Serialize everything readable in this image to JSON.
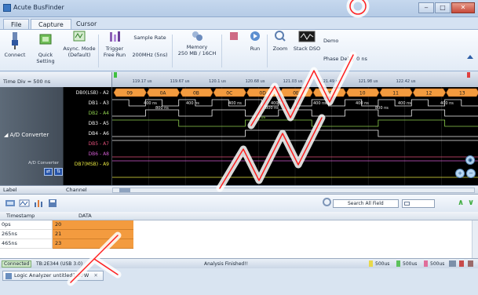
{
  "window": {
    "title": "Acute BusFinder",
    "min": "‒",
    "max": "□",
    "close": "✕"
  },
  "ribbon_tabs": [
    "File",
    "Capture",
    "Cursor"
  ],
  "ribbon": {
    "connect": "Connect",
    "quick_setting": "Quick Setting",
    "async_mode": "Async. Mode",
    "async_default": "(Default)",
    "trigger": "Trigger",
    "free_run": "Free Run",
    "sample_rate": "Sample Rate",
    "sample_rate_val": "200MHz (5ns)",
    "memory": "Memory",
    "memory_val": "250 MB / 16CH",
    "run": "Run",
    "zoom": "Zoom",
    "stack_dso": "Stack DSO",
    "demo": "Demo",
    "phase_delay": "Phase Delay 0 ns"
  },
  "waveform": {
    "time_div": "Time Div = 500 ns",
    "ruler": [
      "119.17 us",
      "119.67 us",
      "120.1 us",
      "120.68 us",
      "121.03 us",
      "121.49 us",
      "121.98 us",
      "122.42 us"
    ],
    "group_label": "A/D Converter",
    "group_label_small": "A/D Converter",
    "channels": [
      {
        "name": "DB0(LSB) - A2",
        "color": "#f0f0f0"
      },
      {
        "name": "DB1 - A3",
        "color": "#f0f0f0"
      },
      {
        "name": "DB2 - A4",
        "color": "#8fd14f"
      },
      {
        "name": "DB3 - A5",
        "color": "#f0f0f0"
      },
      {
        "name": "DB4 - A6",
        "color": "#f0f0f0"
      },
      {
        "name": "DB5 - A7",
        "color": "#e0507a"
      },
      {
        "name": "DB6 - A8",
        "color": "#d05cd0"
      },
      {
        "name": "DB7(MSB) - A9",
        "color": "#e8e840"
      }
    ],
    "bus_values": [
      "09",
      "0A",
      "0B",
      "0C",
      "0D",
      "0E",
      "0F",
      "10",
      "11",
      "12",
      "13"
    ],
    "pulse_labels": [
      "400 ns",
      "400 ns",
      "400 ns",
      "400 ns",
      "400 ns",
      "400 ns",
      "400 ns",
      "400 ns"
    ],
    "pulse_labels_2": [
      "800 ns",
      "800 ns",
      "800 ns"
    ],
    "pulse_label_3": "1.6 us",
    "bus_color": "#f39b3f"
  },
  "label_row": {
    "label": "Label",
    "channel": "Channel"
  },
  "search": {
    "placeholder": "Search All Field"
  },
  "grid": {
    "headers": {
      "timestamp": "Timestamp",
      "data": "DATA"
    },
    "rows": [
      {
        "timestamp": "0ps",
        "data": "20"
      },
      {
        "timestamp": "265ns",
        "data": "21"
      },
      {
        "timestamp": "465ns",
        "data": "23"
      }
    ]
  },
  "status": {
    "connection": "Connected",
    "device": "TB:2E344 (USB 3.0)",
    "state": "Analysis Finished!!",
    "val1": "500us",
    "val2": "500us",
    "val3": "500us"
  },
  "doc_tab": {
    "label": "Logic Analyzer untitled1.BFW",
    "close": "✕"
  },
  "colors": {
    "accent": "#2e5ea7",
    "bus_orange": "#f39b3f",
    "green": "#3cab3c"
  }
}
